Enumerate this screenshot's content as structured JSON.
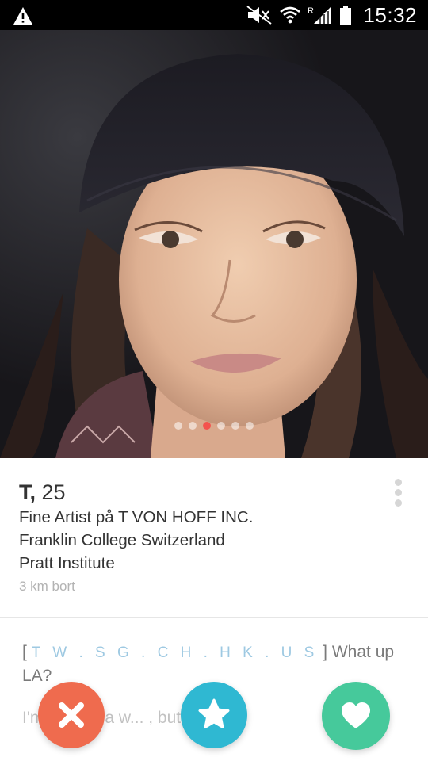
{
  "status_bar": {
    "time": "15:32",
    "icons": [
      "warning-icon",
      "mute-icon",
      "wifi-icon",
      "signal-icon",
      "battery-icon"
    ],
    "roaming_label": "R"
  },
  "photo": {
    "pages": 6,
    "active_page": 3
  },
  "profile": {
    "name": "T,",
    "age": "25",
    "job": "Fine Artist på T VON HOFF INC.",
    "school_1": "Franklin College Switzerland",
    "school_2": "Pratt Institute",
    "distance": "3 km bort"
  },
  "bio": {
    "open_bracket": "[",
    "tags": "TW.SG.CH.HK.US",
    "close_bracket": "]",
    "line_1_rest": "What up",
    "line_2": "LA?",
    "line_3_visible": "I'm ... here a w... , but ayyy"
  },
  "actions": {
    "nope": "close-icon",
    "super_like": "star-icon",
    "like": "heart-icon"
  },
  "colors": {
    "accent_dot": "#f4524d",
    "nope": "#ef6b4e",
    "super_like": "#2fb8d2",
    "like": "#46c99b",
    "tags": "#9ec9e2"
  }
}
